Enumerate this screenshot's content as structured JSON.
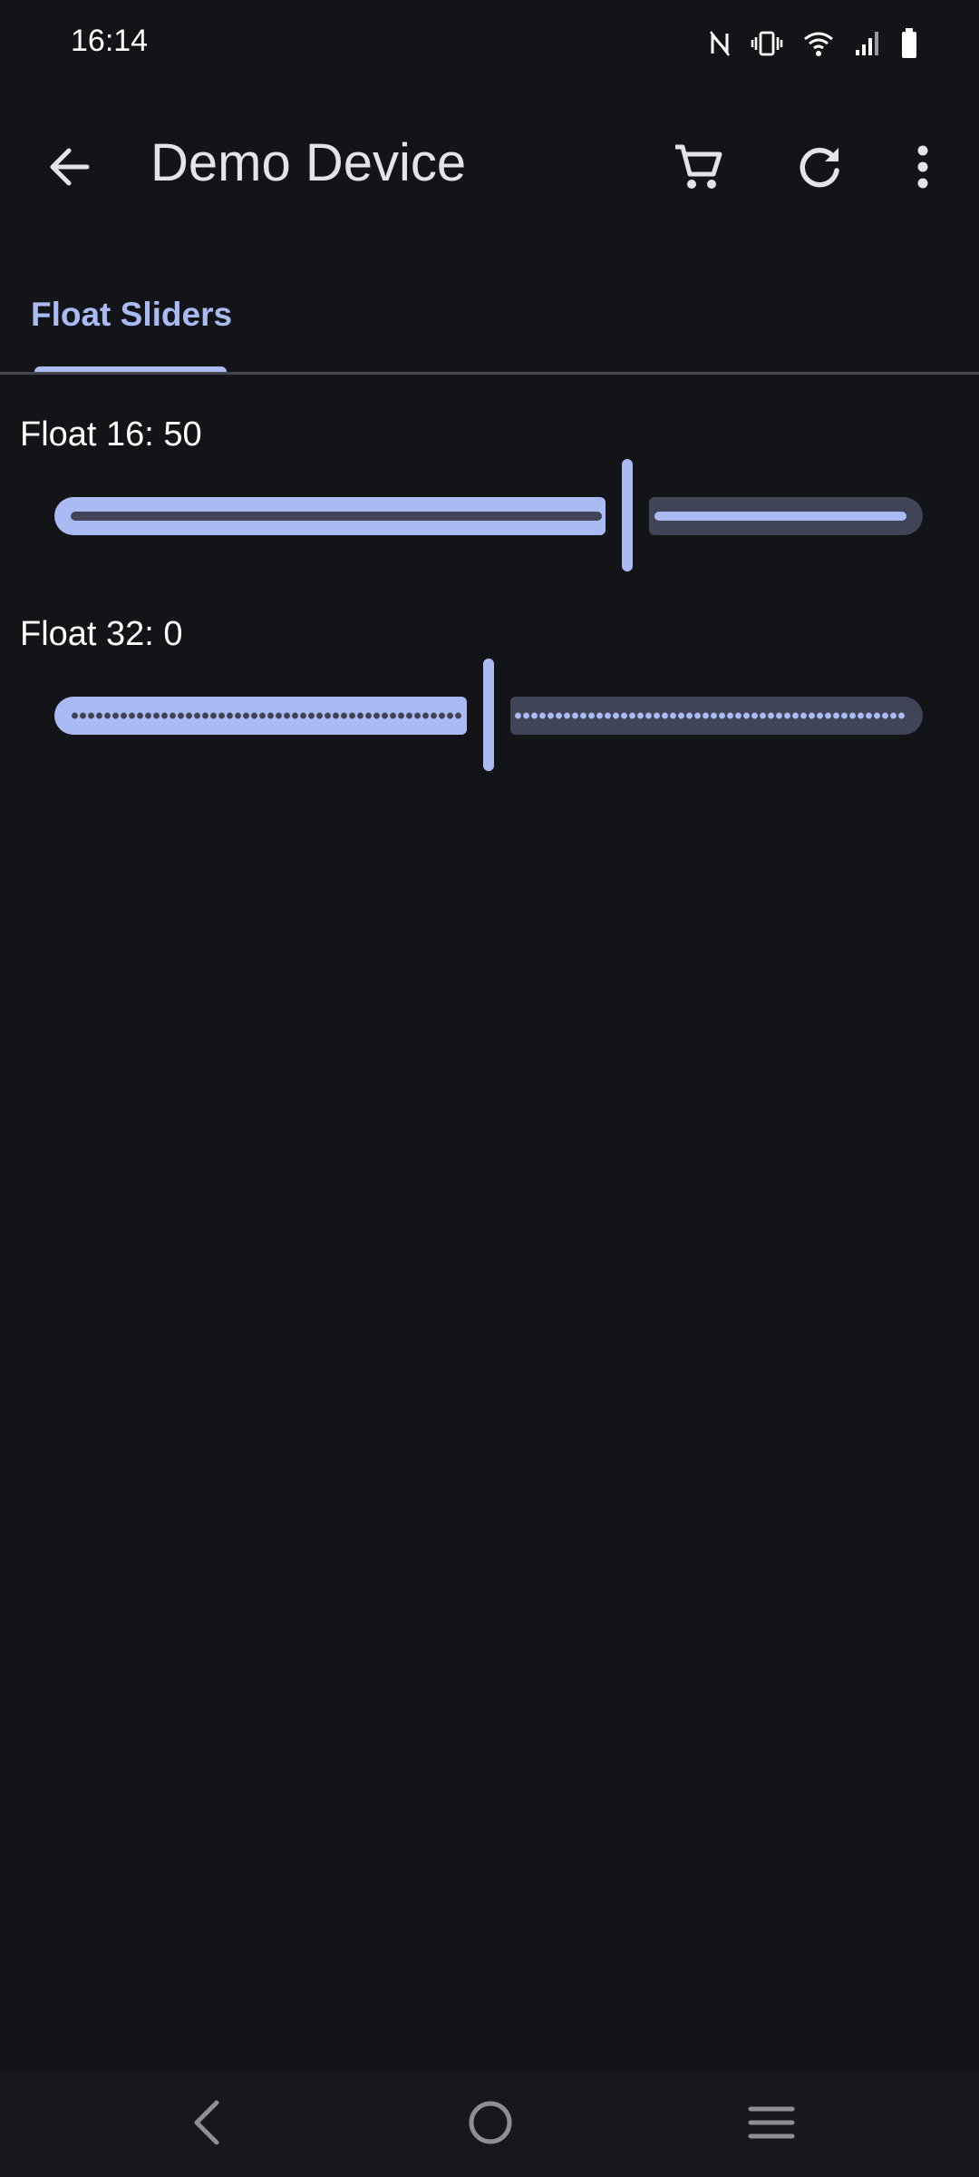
{
  "status_bar": {
    "time": "16:14",
    "icons": [
      "nfc-icon",
      "vibrate-icon",
      "wifi-icon",
      "signal-icon",
      "battery-icon"
    ]
  },
  "app_bar": {
    "title": "Demo Device",
    "actions": [
      "back-arrow-icon",
      "cart-icon",
      "refresh-icon",
      "more-vert-icon"
    ]
  },
  "tabs": [
    {
      "label": "Float Sliders",
      "selected": true
    }
  ],
  "sliders": [
    {
      "label": "Float 16: 50",
      "position_fraction": 0.66
    },
    {
      "label": "Float 32: 0",
      "position_fraction": 0.5
    }
  ],
  "colors": {
    "background": "#131418",
    "accent": "#aabbf3",
    "track_inactive": "#3f4456",
    "text_primary": "#e3e3e8",
    "divider": "#46474c"
  },
  "nav_bar": {
    "buttons": [
      "nav-back-icon",
      "nav-home-icon",
      "nav-recents-icon"
    ]
  }
}
